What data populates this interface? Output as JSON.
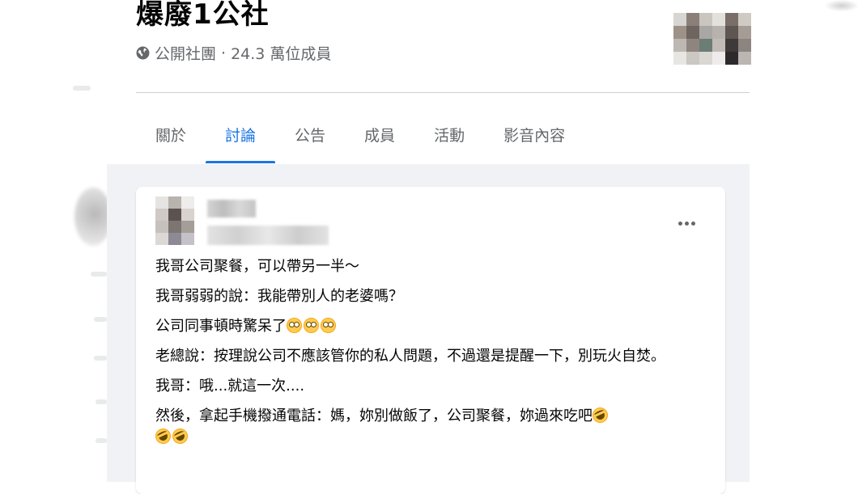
{
  "group": {
    "name": "爆廢1公社",
    "privacy": "公開社團",
    "separator": "·",
    "members": "24.3 萬位成員"
  },
  "tabs": [
    {
      "label": "關於",
      "active": false
    },
    {
      "label": "討論",
      "active": true
    },
    {
      "label": "公告",
      "active": false
    },
    {
      "label": "成員",
      "active": false
    },
    {
      "label": "活動",
      "active": false
    },
    {
      "label": "影音內容",
      "active": false
    }
  ],
  "post": {
    "lines": [
      "我哥公司聚餐，可以帶另一半～",
      "我哥弱弱的說：我能帶別人的老婆嗎？",
      "公司同事頓時驚呆了",
      "老總說：按理說公司不應該管你的私人問題，不過還是提醒一下，別玩火自焚。",
      "我哥：哦...就這一次....",
      "然後，拿起手機撥通電話：媽，妳別做飯了，公司聚餐，妳過來吃吧"
    ],
    "emojis": {
      "line3": [
        "flushed-face",
        "flushed-face",
        "flushed-face"
      ],
      "line6": [
        "rolling-on-floor-laughing",
        "rolling-on-floor-laughing",
        "rolling-on-floor-laughing"
      ]
    }
  },
  "colors": {
    "accent": "#1b74e4",
    "secondary_text": "#65676b",
    "feed_background": "#f0f2f5"
  }
}
